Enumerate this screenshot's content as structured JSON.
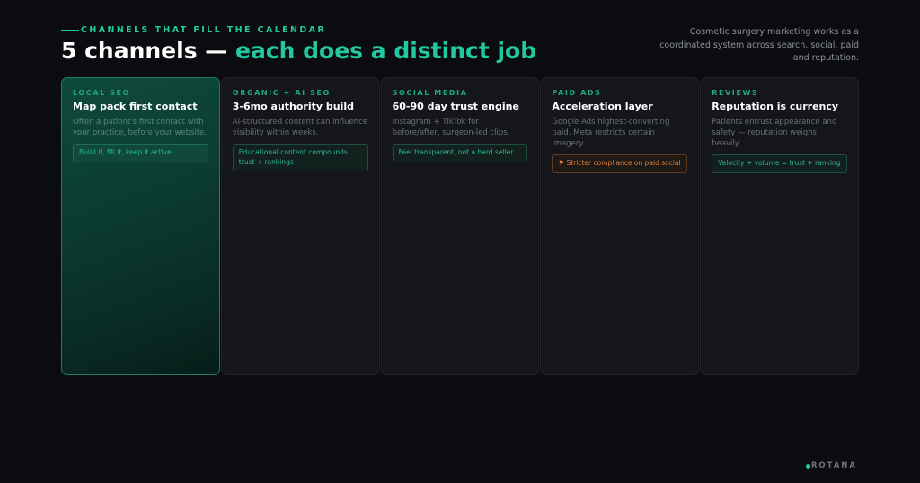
{
  "header": {
    "eyebrow": "CHANNELS THAT FILL THE CALENDAR",
    "title_main": "5 channels — ",
    "title_accent": "each does a distinct job",
    "intro": "Cosmetic surgery marketing works as a coordinated system across search, social, paid and reputation."
  },
  "cards": [
    {
      "eyebrow": "LOCAL SEO",
      "title": "Map pack first contact",
      "desc": "Often a patient's first contact with your practice, before your website.",
      "tag": "Build it, fill it, keep it active",
      "tag_type": "normal"
    },
    {
      "eyebrow": "ORGANIC + AI SEO",
      "title": "3-6mo authority build",
      "desc": "AI-structured content can influence visibility within weeks.",
      "tag": "Educational content compounds trust + rankings",
      "tag_type": "normal"
    },
    {
      "eyebrow": "SOCIAL MEDIA",
      "title": "60-90 day trust engine",
      "desc": "Instagram + TikTok for before/after, surgeon-led clips.",
      "tag": "Feel transparent, not a hard seller",
      "tag_type": "normal"
    },
    {
      "eyebrow": "PAID ADS",
      "title": "Acceleration layer",
      "desc": "Google Ads highest-converting paid. Meta restricts certain imagery.",
      "tag": "⚑ Stricter compliance on paid social",
      "tag_type": "warn"
    },
    {
      "eyebrow": "REVIEWS",
      "title": "Reputation is currency",
      "desc": "Patients entrust appearance and safety — reputation weighs heavily.",
      "tag": "Velocity + volume = trust + ranking",
      "tag_type": "normal"
    }
  ],
  "logo": {
    "text": "ROTANA"
  },
  "colors": {
    "accent": "#22c9a0",
    "warning": "#e0833d",
    "background": "#0b0c10"
  }
}
